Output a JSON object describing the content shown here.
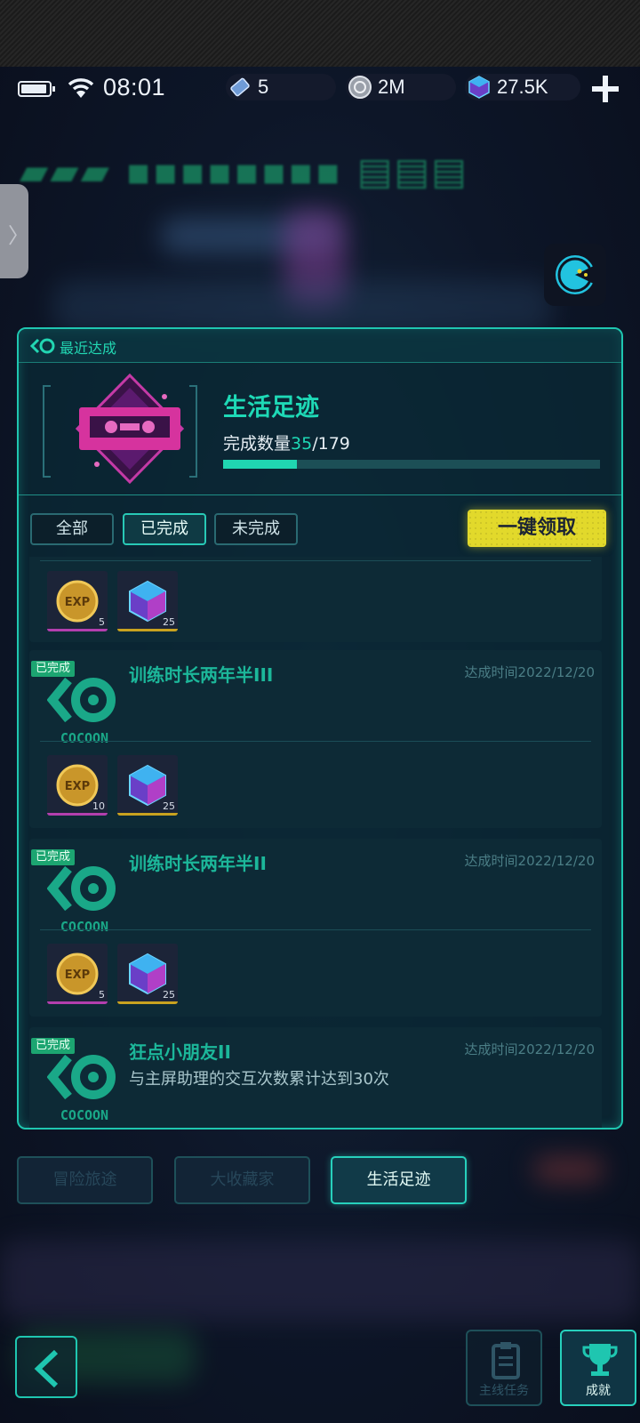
{
  "status_bar": {
    "time": "08:01"
  },
  "resources": [
    {
      "icon": "ticket-icon",
      "value": "5"
    },
    {
      "icon": "coin-icon",
      "value": "2M"
    },
    {
      "icon": "cube-gem-icon",
      "value": "27.5K"
    }
  ],
  "panel": {
    "header_label": "最近达成",
    "category_title": "生活足迹",
    "count_label": "完成数量",
    "count_done": "35",
    "count_total": "/179",
    "progress_fraction": 0.196,
    "filters": [
      "全部",
      "已完成",
      "未完成"
    ],
    "active_filter": 1,
    "claim_all_label": "一键领取"
  },
  "achievements": [
    {
      "status": "已完成",
      "title": "训练时长两年半III",
      "time": "达成时间2022/12/20",
      "rewards": [
        {
          "type": "exp",
          "qty": "10"
        },
        {
          "type": "gem",
          "qty": "25"
        }
      ]
    },
    {
      "status": "已完成",
      "title": "训练时长两年半II",
      "time": "达成时间2022/12/20",
      "rewards": [
        {
          "type": "exp",
          "qty": "5"
        },
        {
          "type": "gem",
          "qty": "25"
        }
      ]
    },
    {
      "status": "已完成",
      "title": "狂点小朋友II",
      "description": "与主屏助理的交互次数累计达到30次",
      "time": "达成时间2022/12/20"
    }
  ],
  "top_partial_rewards": [
    {
      "type": "exp",
      "qty": "5"
    },
    {
      "type": "gem",
      "qty": "25"
    }
  ],
  "logo_text": "COCOON",
  "bottom_tabs": [
    "冒险旅途",
    "大收藏家",
    "生活足迹"
  ],
  "active_bottom_tab": 2,
  "nav": {
    "main_quest_label": "主线任务",
    "achievements_label": "成就"
  },
  "colors": {
    "accent": "#1fc6b0",
    "claim": "#e2d92b",
    "done_tag": "#1ca571"
  }
}
